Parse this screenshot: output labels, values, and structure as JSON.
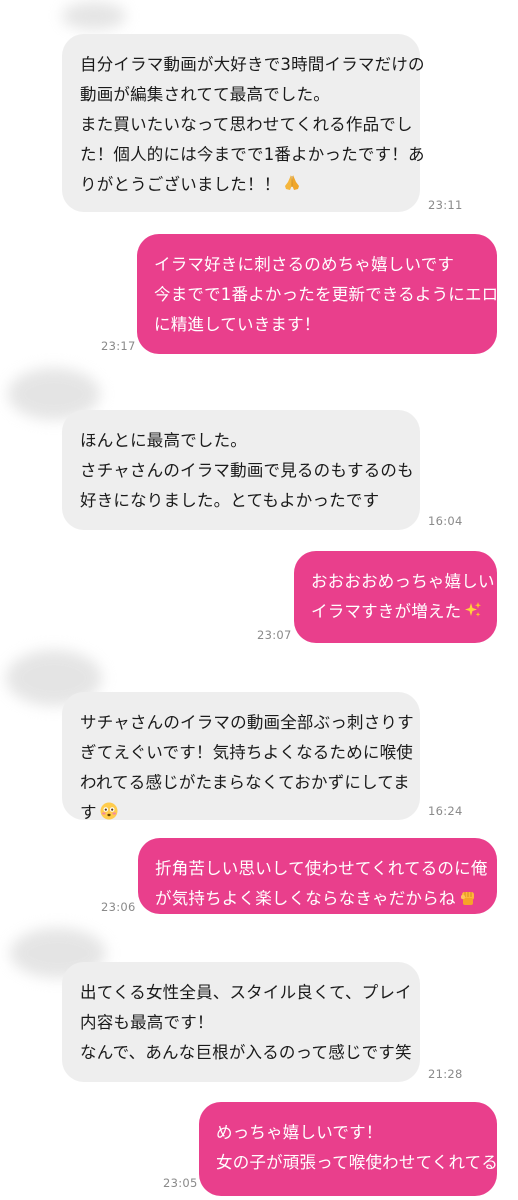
{
  "messages": [
    {
      "side": "received",
      "lines": [
        "自分イラマ動画が大好きで3時間イラマだけの",
        "動画が編集されてて最高でした。",
        "また買いたいなって思わせてくれる作品でし",
        "た！個人的には今までで1番よかったです！あ",
        "りがとうございました！！"
      ],
      "emoji": "folded-hands",
      "time": "23:11"
    },
    {
      "side": "sent",
      "lines": [
        "イラマ好きに刺さるのめちゃ嬉しいです",
        "今までで1番よかったを更新できるようにエロ",
        "に精進していきます！"
      ],
      "time": "23:17"
    },
    {
      "side": "received",
      "lines": [
        "ほんとに最高でした。",
        "さチャさんのイラマ動画で見るのもするのも",
        "好きになりました。とてもよかったです"
      ],
      "time": "16:04"
    },
    {
      "side": "sent",
      "lines": [
        "おおおおめっちゃ嬉しい",
        "イラマすきが増えた"
      ],
      "emoji": "sparkles",
      "time": "23:07"
    },
    {
      "side": "received",
      "lines": [
        "サチャさんのイラマの動画全部ぶっ刺さりす",
        "ぎてえぐいです！気持ちよくなるために喉使",
        "われてる感じがたまらなくておかずにしてま",
        "す"
      ],
      "emoji": "flushed-face",
      "time": "16:24"
    },
    {
      "side": "sent",
      "lines": [
        "折角苦しい思いして使わせてくれてるのに俺",
        "が気持ちよく楽しくならなきゃだからね"
      ],
      "emoji": "raised-fist",
      "time": "23:06"
    },
    {
      "side": "received",
      "lines": [
        "出てくる女性全員、スタイル良くて、プレイ",
        "内容も最高です！",
        "なんで、あんな巨根が入るのって感じです笑"
      ],
      "time": "21:28"
    },
    {
      "side": "sent",
      "lines": [
        "めっちゃ嬉しいです！",
        "女の子が頑張って喉使わせてくれてる"
      ],
      "time": "23:05"
    }
  ],
  "colors": {
    "sent_bubble": "#e93f8c",
    "received_bubble": "#eeeeee",
    "timestamp": "#8a8a8a"
  }
}
